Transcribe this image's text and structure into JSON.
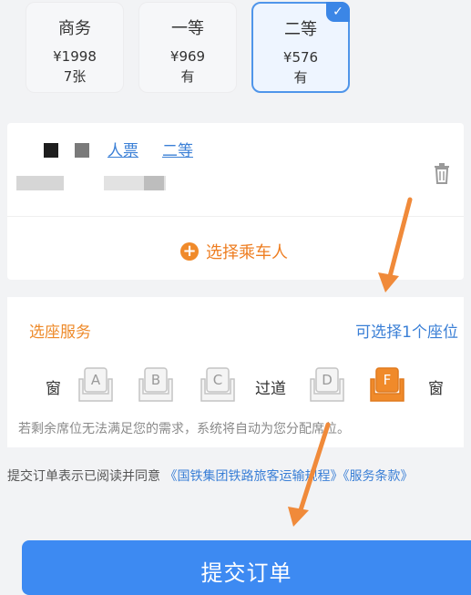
{
  "seat_classes": [
    {
      "name": "商务",
      "price": "¥1998",
      "availability": "7张",
      "selected": false
    },
    {
      "name": "一等",
      "price": "¥969",
      "availability": "有",
      "selected": false
    },
    {
      "name": "二等",
      "price": "¥576",
      "availability": "有",
      "selected": true
    }
  ],
  "passenger": {
    "ticket_type": "人票",
    "seat_class": "二等",
    "add_label": "选择乘车人"
  },
  "seat_service": {
    "title": "选座服务",
    "selectable_count": "可选择1个座位",
    "window_left": "窗",
    "aisle": "过道",
    "window_right": "窗",
    "seats": [
      "A",
      "B",
      "C",
      "D",
      "F"
    ],
    "selected_seat": "F",
    "note": "若剩余席位无法满足您的需求，系统将自动为您分配席位。"
  },
  "agreement": {
    "prefix": "提交订单表示已阅读并同意",
    "link1": "《国铁集团铁路旅客运输规程》",
    "link2": "《服务条款》"
  },
  "submit_label": "提交订单",
  "colors": {
    "accent_blue": "#3d8af2",
    "accent_orange": "#f08a2a",
    "link_blue": "#3a7fd6"
  }
}
